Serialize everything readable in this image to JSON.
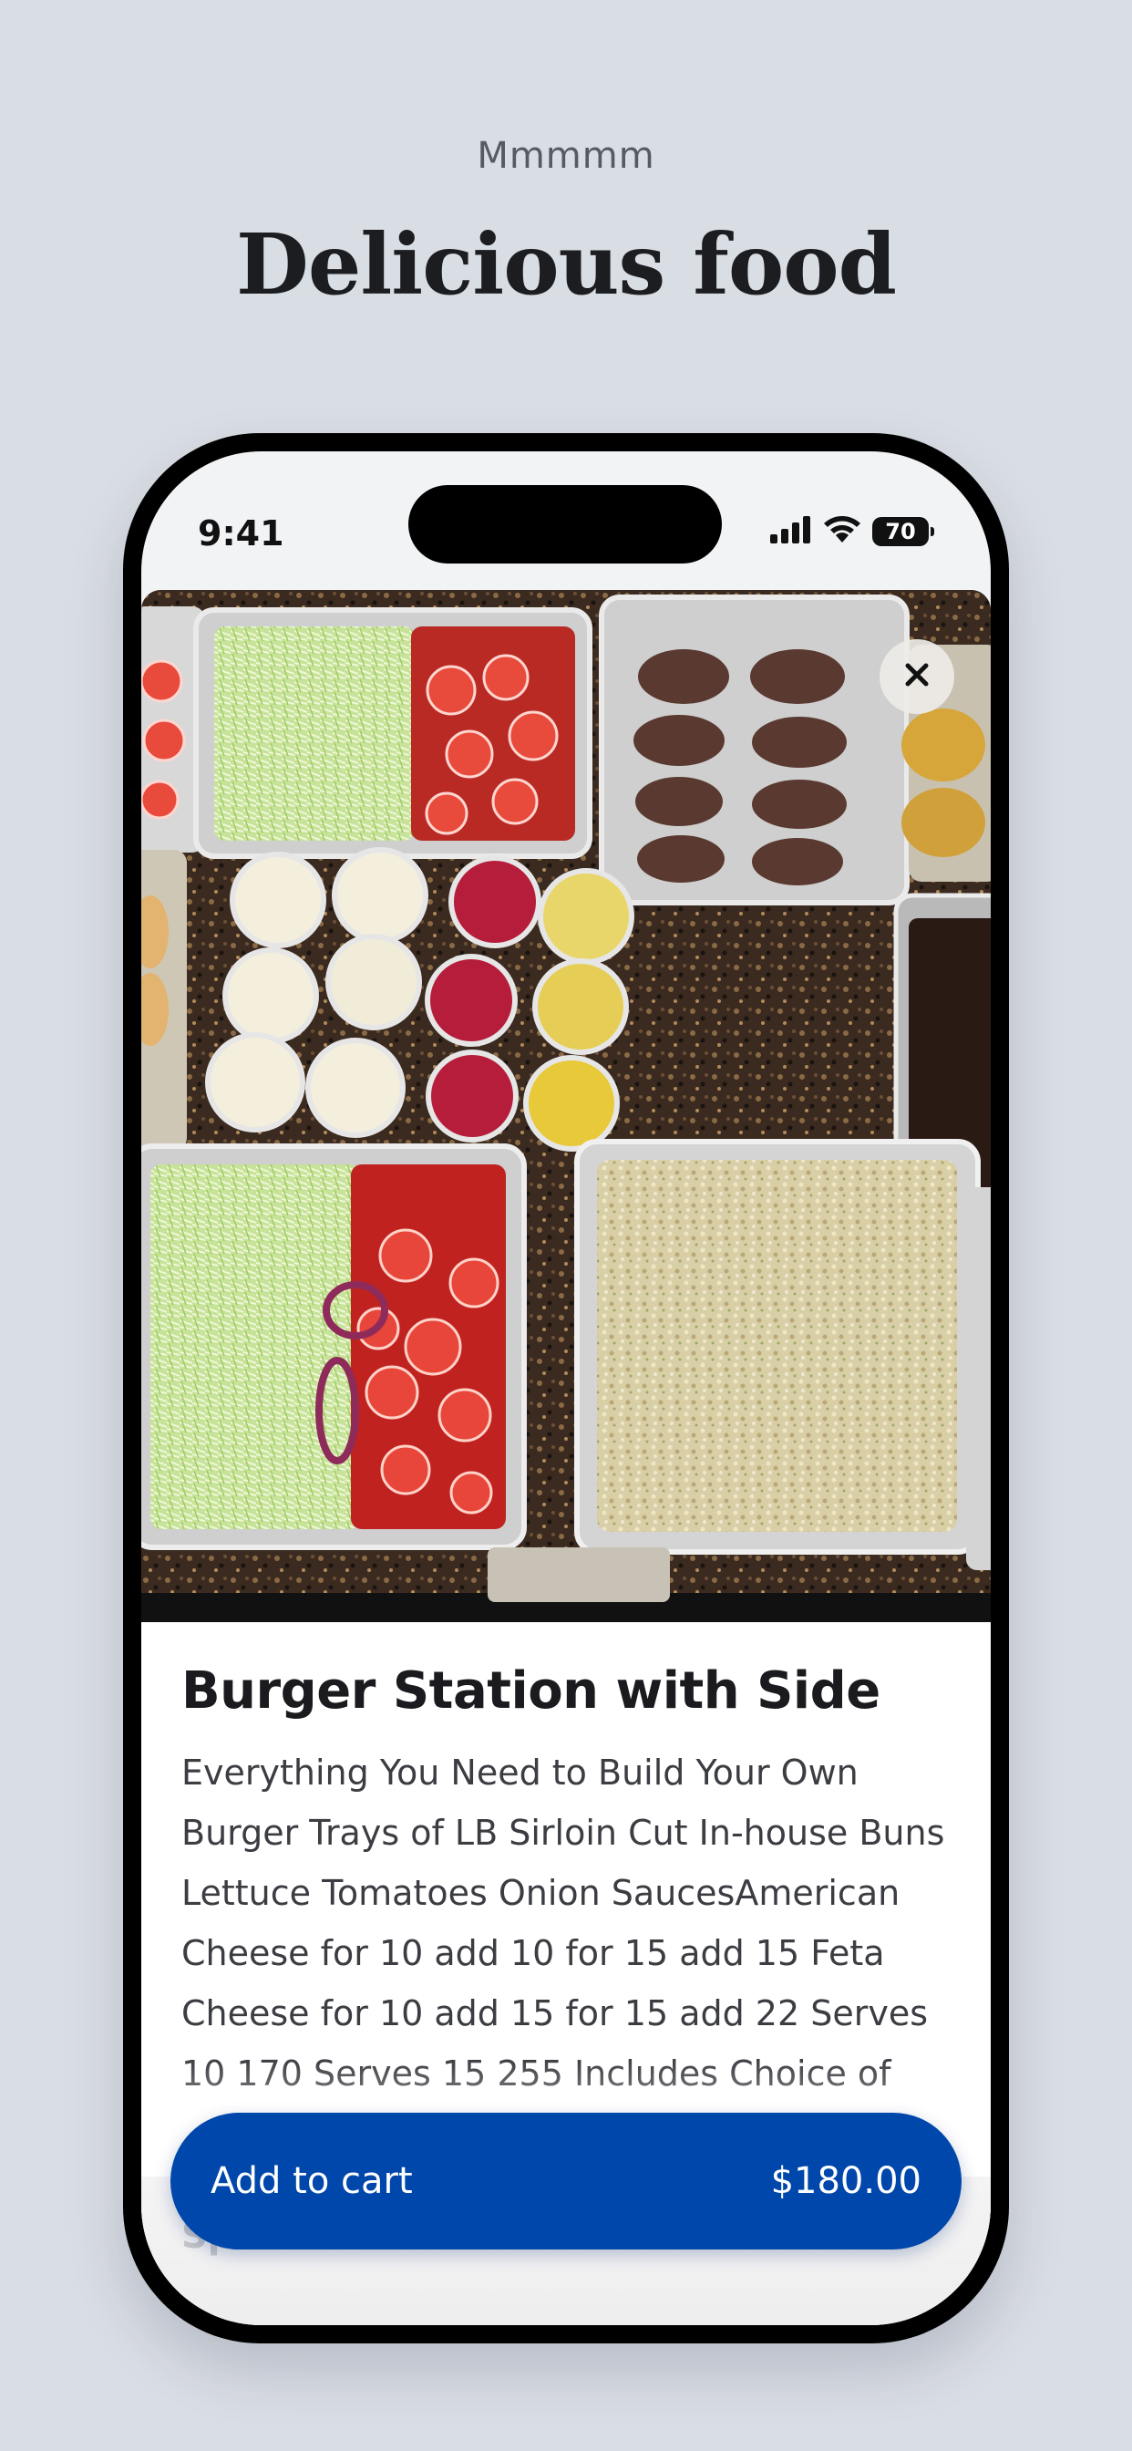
{
  "page": {
    "eyebrow": "Mmmmm",
    "headline": "Delicious food"
  },
  "status_bar": {
    "time": "9:41",
    "battery": "70"
  },
  "item": {
    "photo_alt": "Catering trays with lettuce, tomatoes, onions, sauces, burger patties and rice",
    "title": "Burger Station with Side",
    "description": "Everything You Need to Build Your Own Burger Trays of LB Sirloin Cut In-house Buns Lettuce Tomatoes Onion SaucesAmerican Cheese for 10 add 10 for 15 add 15 Feta Cheese for 10 add 15 for 15 add 22 Serves 10 170 Serves 15 255 Includes Choice of Rice Fries Salad Big Mac Mac Salad Tomato"
  },
  "special_instructions_label": "Special instructions",
  "cart_button": {
    "label": "Add to cart",
    "price": "$180.00"
  },
  "colors": {
    "background": "#d9dde4",
    "accent": "#0047ab"
  },
  "icons": [
    "signal-icon",
    "wifi-icon",
    "battery-icon",
    "close-icon"
  ]
}
